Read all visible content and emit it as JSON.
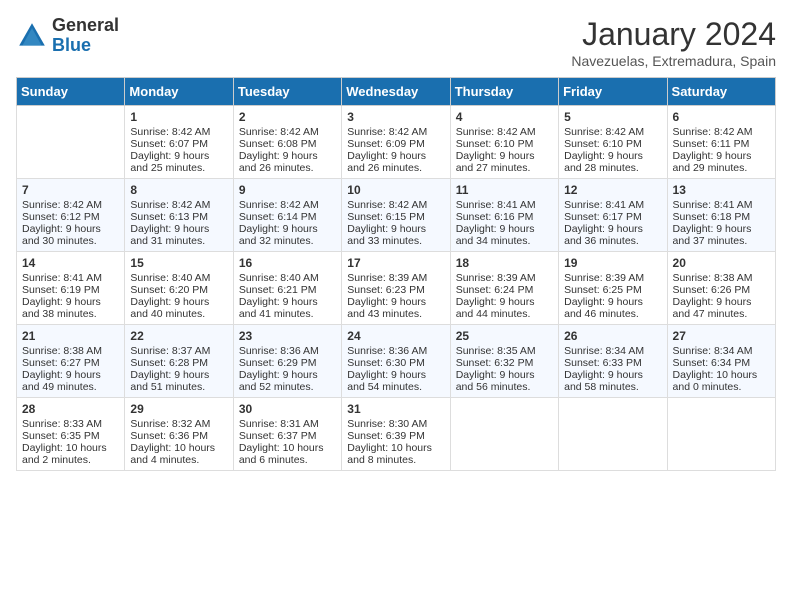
{
  "header": {
    "logo_general": "General",
    "logo_blue": "Blue",
    "month_title": "January 2024",
    "subtitle": "Navezuelas, Extremadura, Spain"
  },
  "days_of_week": [
    "Sunday",
    "Monday",
    "Tuesday",
    "Wednesday",
    "Thursday",
    "Friday",
    "Saturday"
  ],
  "weeks": [
    [
      {
        "day": "",
        "sunrise": "",
        "sunset": "",
        "daylight": ""
      },
      {
        "day": "1",
        "sunrise": "Sunrise: 8:42 AM",
        "sunset": "Sunset: 6:07 PM",
        "daylight": "Daylight: 9 hours and 25 minutes."
      },
      {
        "day": "2",
        "sunrise": "Sunrise: 8:42 AM",
        "sunset": "Sunset: 6:08 PM",
        "daylight": "Daylight: 9 hours and 26 minutes."
      },
      {
        "day": "3",
        "sunrise": "Sunrise: 8:42 AM",
        "sunset": "Sunset: 6:09 PM",
        "daylight": "Daylight: 9 hours and 26 minutes."
      },
      {
        "day": "4",
        "sunrise": "Sunrise: 8:42 AM",
        "sunset": "Sunset: 6:10 PM",
        "daylight": "Daylight: 9 hours and 27 minutes."
      },
      {
        "day": "5",
        "sunrise": "Sunrise: 8:42 AM",
        "sunset": "Sunset: 6:10 PM",
        "daylight": "Daylight: 9 hours and 28 minutes."
      },
      {
        "day": "6",
        "sunrise": "Sunrise: 8:42 AM",
        "sunset": "Sunset: 6:11 PM",
        "daylight": "Daylight: 9 hours and 29 minutes."
      }
    ],
    [
      {
        "day": "7",
        "sunrise": "Sunrise: 8:42 AM",
        "sunset": "Sunset: 6:12 PM",
        "daylight": "Daylight: 9 hours and 30 minutes."
      },
      {
        "day": "8",
        "sunrise": "Sunrise: 8:42 AM",
        "sunset": "Sunset: 6:13 PM",
        "daylight": "Daylight: 9 hours and 31 minutes."
      },
      {
        "day": "9",
        "sunrise": "Sunrise: 8:42 AM",
        "sunset": "Sunset: 6:14 PM",
        "daylight": "Daylight: 9 hours and 32 minutes."
      },
      {
        "day": "10",
        "sunrise": "Sunrise: 8:42 AM",
        "sunset": "Sunset: 6:15 PM",
        "daylight": "Daylight: 9 hours and 33 minutes."
      },
      {
        "day": "11",
        "sunrise": "Sunrise: 8:41 AM",
        "sunset": "Sunset: 6:16 PM",
        "daylight": "Daylight: 9 hours and 34 minutes."
      },
      {
        "day": "12",
        "sunrise": "Sunrise: 8:41 AM",
        "sunset": "Sunset: 6:17 PM",
        "daylight": "Daylight: 9 hours and 36 minutes."
      },
      {
        "day": "13",
        "sunrise": "Sunrise: 8:41 AM",
        "sunset": "Sunset: 6:18 PM",
        "daylight": "Daylight: 9 hours and 37 minutes."
      }
    ],
    [
      {
        "day": "14",
        "sunrise": "Sunrise: 8:41 AM",
        "sunset": "Sunset: 6:19 PM",
        "daylight": "Daylight: 9 hours and 38 minutes."
      },
      {
        "day": "15",
        "sunrise": "Sunrise: 8:40 AM",
        "sunset": "Sunset: 6:20 PM",
        "daylight": "Daylight: 9 hours and 40 minutes."
      },
      {
        "day": "16",
        "sunrise": "Sunrise: 8:40 AM",
        "sunset": "Sunset: 6:21 PM",
        "daylight": "Daylight: 9 hours and 41 minutes."
      },
      {
        "day": "17",
        "sunrise": "Sunrise: 8:39 AM",
        "sunset": "Sunset: 6:23 PM",
        "daylight": "Daylight: 9 hours and 43 minutes."
      },
      {
        "day": "18",
        "sunrise": "Sunrise: 8:39 AM",
        "sunset": "Sunset: 6:24 PM",
        "daylight": "Daylight: 9 hours and 44 minutes."
      },
      {
        "day": "19",
        "sunrise": "Sunrise: 8:39 AM",
        "sunset": "Sunset: 6:25 PM",
        "daylight": "Daylight: 9 hours and 46 minutes."
      },
      {
        "day": "20",
        "sunrise": "Sunrise: 8:38 AM",
        "sunset": "Sunset: 6:26 PM",
        "daylight": "Daylight: 9 hours and 47 minutes."
      }
    ],
    [
      {
        "day": "21",
        "sunrise": "Sunrise: 8:38 AM",
        "sunset": "Sunset: 6:27 PM",
        "daylight": "Daylight: 9 hours and 49 minutes."
      },
      {
        "day": "22",
        "sunrise": "Sunrise: 8:37 AM",
        "sunset": "Sunset: 6:28 PM",
        "daylight": "Daylight: 9 hours and 51 minutes."
      },
      {
        "day": "23",
        "sunrise": "Sunrise: 8:36 AM",
        "sunset": "Sunset: 6:29 PM",
        "daylight": "Daylight: 9 hours and 52 minutes."
      },
      {
        "day": "24",
        "sunrise": "Sunrise: 8:36 AM",
        "sunset": "Sunset: 6:30 PM",
        "daylight": "Daylight: 9 hours and 54 minutes."
      },
      {
        "day": "25",
        "sunrise": "Sunrise: 8:35 AM",
        "sunset": "Sunset: 6:32 PM",
        "daylight": "Daylight: 9 hours and 56 minutes."
      },
      {
        "day": "26",
        "sunrise": "Sunrise: 8:34 AM",
        "sunset": "Sunset: 6:33 PM",
        "daylight": "Daylight: 9 hours and 58 minutes."
      },
      {
        "day": "27",
        "sunrise": "Sunrise: 8:34 AM",
        "sunset": "Sunset: 6:34 PM",
        "daylight": "Daylight: 10 hours and 0 minutes."
      }
    ],
    [
      {
        "day": "28",
        "sunrise": "Sunrise: 8:33 AM",
        "sunset": "Sunset: 6:35 PM",
        "daylight": "Daylight: 10 hours and 2 minutes."
      },
      {
        "day": "29",
        "sunrise": "Sunrise: 8:32 AM",
        "sunset": "Sunset: 6:36 PM",
        "daylight": "Daylight: 10 hours and 4 minutes."
      },
      {
        "day": "30",
        "sunrise": "Sunrise: 8:31 AM",
        "sunset": "Sunset: 6:37 PM",
        "daylight": "Daylight: 10 hours and 6 minutes."
      },
      {
        "day": "31",
        "sunrise": "Sunrise: 8:30 AM",
        "sunset": "Sunset: 6:39 PM",
        "daylight": "Daylight: 10 hours and 8 minutes."
      },
      {
        "day": "",
        "sunrise": "",
        "sunset": "",
        "daylight": ""
      },
      {
        "day": "",
        "sunrise": "",
        "sunset": "",
        "daylight": ""
      },
      {
        "day": "",
        "sunrise": "",
        "sunset": "",
        "daylight": ""
      }
    ]
  ]
}
